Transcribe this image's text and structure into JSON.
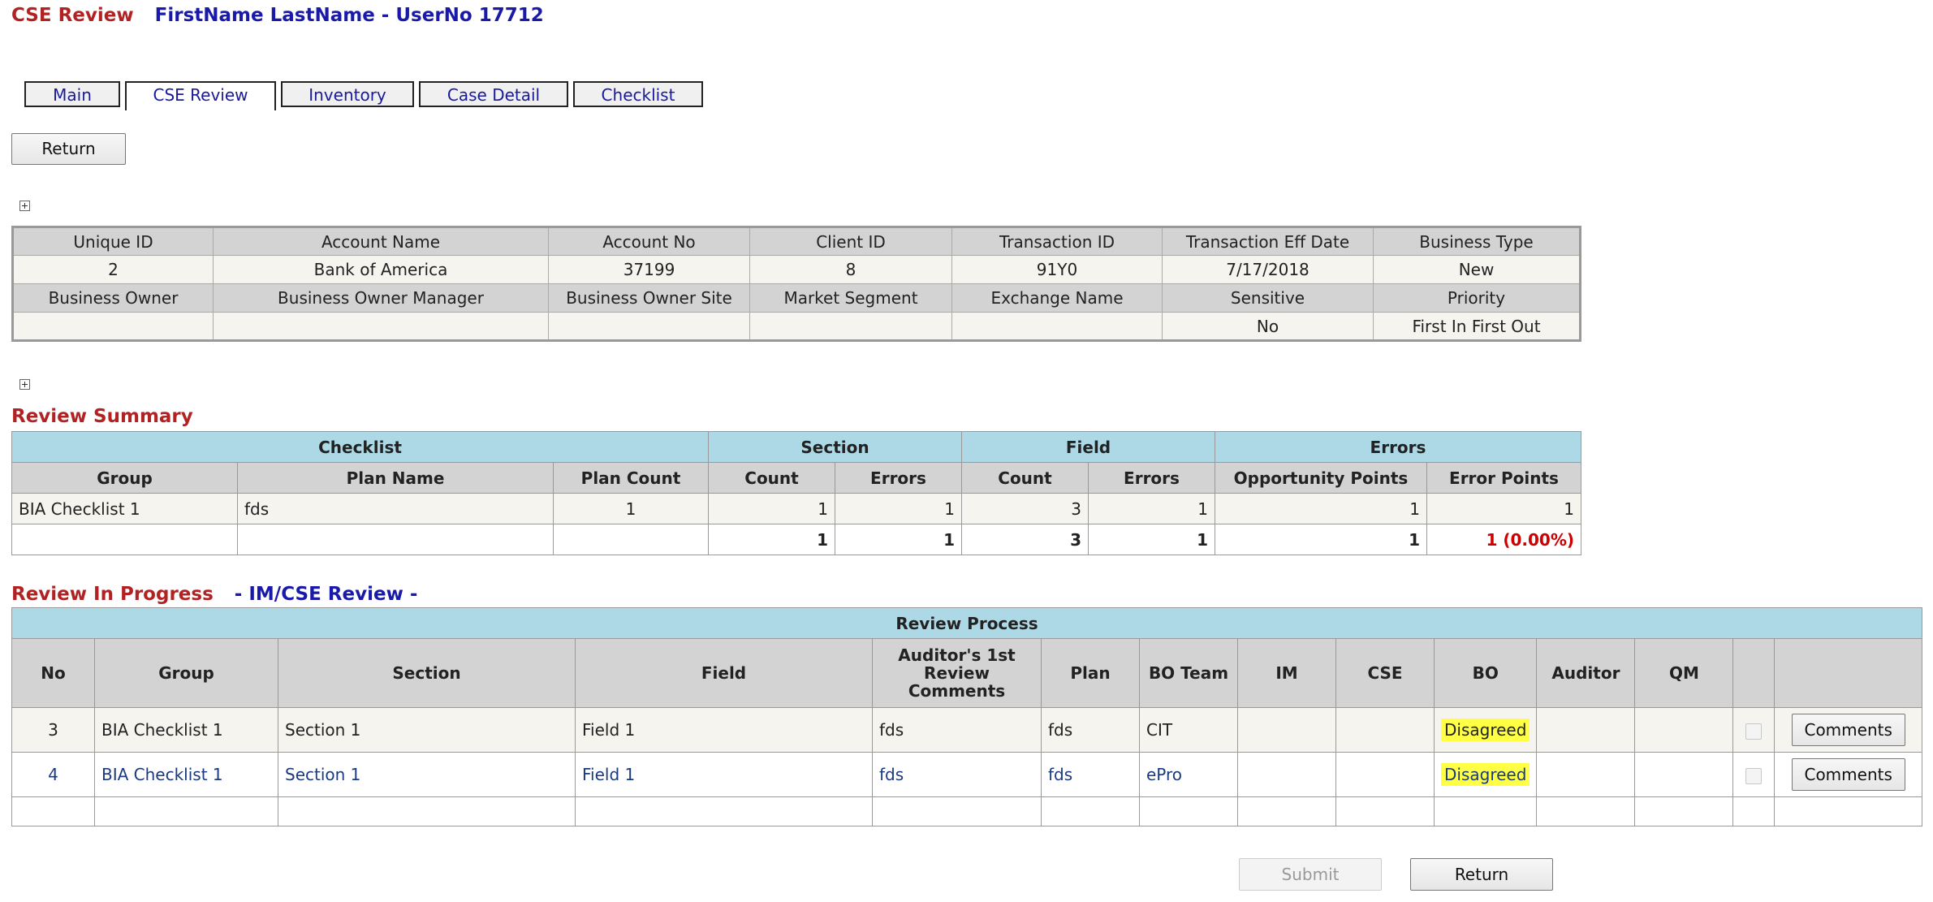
{
  "header": {
    "title": "CSE Review",
    "user": "FirstName LastName - UserNo 17712"
  },
  "tabs": [
    {
      "label": "Main"
    },
    {
      "label": "CSE Review"
    },
    {
      "label": "Inventory"
    },
    {
      "label": "Case Detail"
    },
    {
      "label": "Checklist"
    }
  ],
  "return_button": "Return",
  "info": {
    "row1_headers": [
      "Unique ID",
      "Account Name",
      "Account No",
      "Client ID",
      "Transaction ID",
      "Transaction Eff Date",
      "Business Type"
    ],
    "row1_values": [
      "2",
      "Bank of America",
      "37199",
      "8",
      "91Y0",
      "7/17/2018",
      "New"
    ],
    "row2_headers": [
      "Business Owner",
      "Business Owner Manager",
      "Business Owner Site",
      "Market Segment",
      "Exchange Name",
      "Sensitive",
      "Priority"
    ],
    "row2_values": [
      "",
      "",
      "",
      "",
      "",
      "No",
      "First In First Out"
    ]
  },
  "summary": {
    "title": "Review Summary",
    "groups": [
      "Checklist",
      "Section",
      "Field",
      "Errors"
    ],
    "columns": [
      "Group",
      "Plan Name",
      "Plan Count",
      "Count",
      "Errors",
      "Count",
      "Errors",
      "Opportunity Points",
      "Error Points"
    ],
    "rows": [
      [
        "BIA Checklist 1",
        "fds",
        "1",
        "1",
        "1",
        "3",
        "1",
        "1",
        "1"
      ]
    ],
    "totals": [
      "",
      "",
      "",
      "1",
      "1",
      "3",
      "1",
      "1",
      "1 (0.00%)"
    ]
  },
  "progress": {
    "title": "Review In Progress",
    "subtitle": "- IM/CSE Review -",
    "table_title": "Review Process",
    "columns": [
      "No",
      "Group",
      "Section",
      "Field",
      "Auditor's 1st Review Comments",
      "Plan",
      "BO Team",
      "IM",
      "CSE",
      "BO",
      "Auditor",
      "QM",
      "",
      ""
    ],
    "rows": [
      {
        "no": "3",
        "group": "BIA Checklist 1",
        "section": "Section 1",
        "field": "Field 1",
        "comments": "fds",
        "plan": "fds",
        "bo_team": "CIT",
        "im": "",
        "cse": "",
        "bo": "Disagreed",
        "auditor": "",
        "qm": "",
        "button": "Comments"
      },
      {
        "no": "4",
        "group": "BIA Checklist 1",
        "section": "Section 1",
        "field": "Field 1",
        "comments": "fds",
        "plan": "fds",
        "bo_team": "ePro",
        "im": "",
        "cse": "",
        "bo": "Disagreed",
        "auditor": "",
        "qm": "",
        "button": "Comments"
      }
    ]
  },
  "footer": {
    "submit": "Submit",
    "return": "Return"
  }
}
